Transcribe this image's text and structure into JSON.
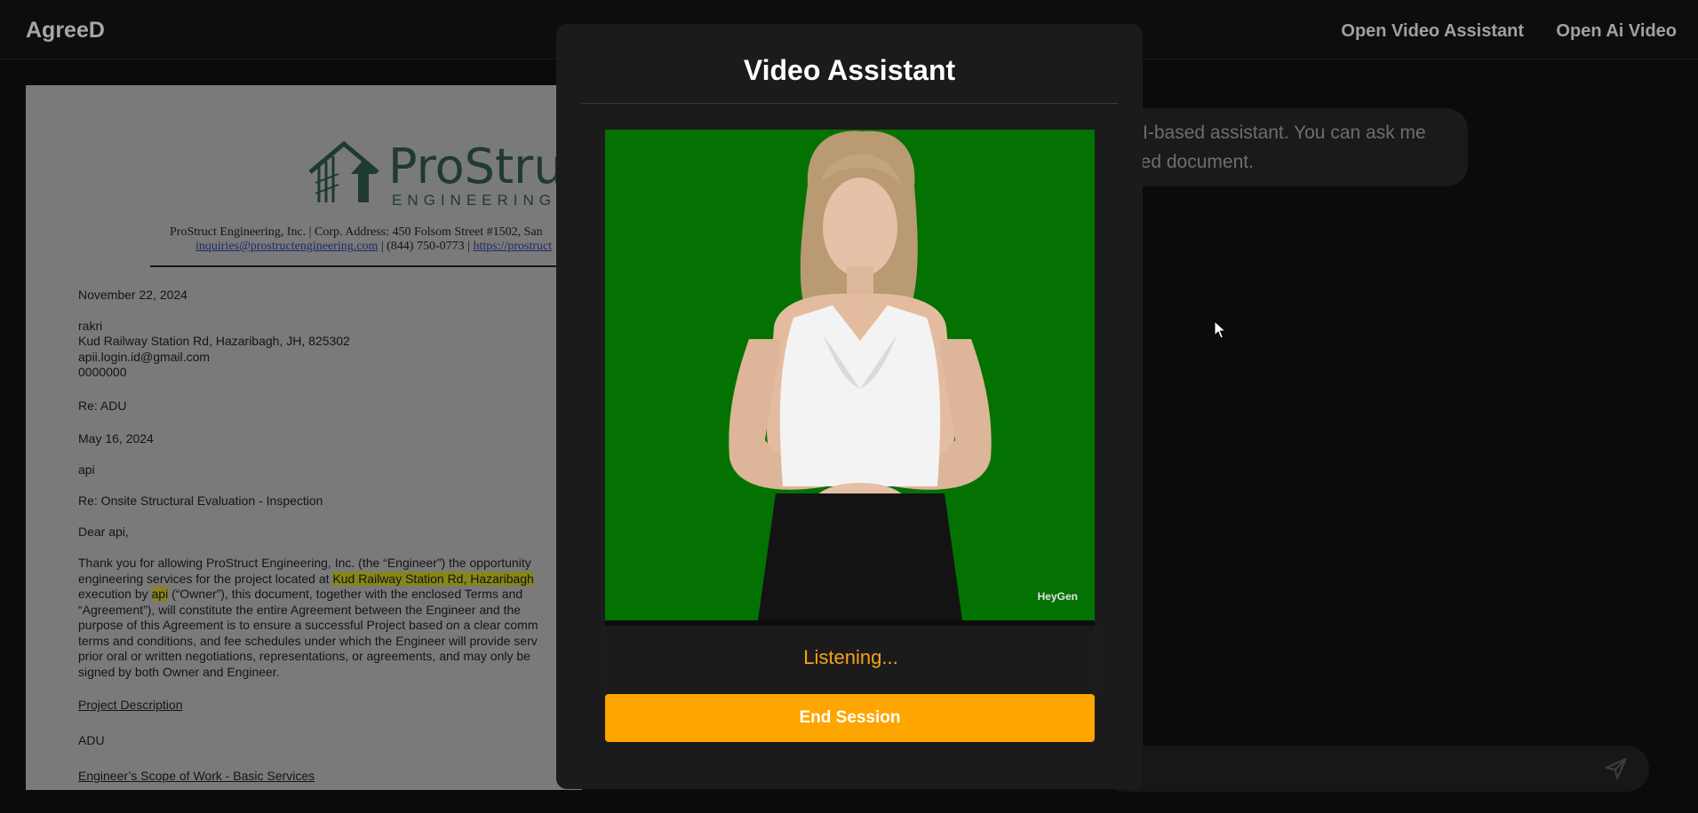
{
  "header": {
    "brand": "AgreeD",
    "nav": [
      "Open Video Assistant",
      "Open Ai Video"
    ]
  },
  "document": {
    "logo_name": "ProStruct",
    "logo_sub": "ENGINEERING",
    "address_line": "ProStruct Engineering, Inc. | Corp. Address: 450 Folsom Street #1502, San",
    "email_link": "inquiries@prostructengineering.com",
    "phone": " | (844) 750-0773 | ",
    "site_link": "https://prostruct",
    "date": "November 22, 2024",
    "client_name": "rakri",
    "client_address": "Kud Railway Station Rd, Hazaribagh, JH, 825302",
    "client_email": "apii.login.id@gmail.com",
    "client_phone": "0000000",
    "re_project": "Re: ADU",
    "second_date": "May 16, 2024",
    "owner": "api",
    "re_subject": "Re: Onsite Structural Evaluation - Inspection",
    "salutation": "Dear api,",
    "body": {
      "l1": "Thank you for allowing ProStruct Engineering, Inc. (the “Engineer”) the opportunity",
      "l2_pre": "engineering services for the project located at ",
      "l2_hl": "Kud Railway Station Rd, Hazaribagh",
      "l3_pre": "execution by ",
      "l3_hl": "api",
      "l3_post": " (“Owner”), this document, together with the enclosed Terms and",
      "l4": "“Agreement”), will constitute the entire Agreement between the Engineer and the",
      "l5": "purpose of this Agreement is to ensure a successful Project based on a clear comm",
      "l6": "terms and conditions, and fee schedules under which the Engineer will provide serv",
      "l7": "prior oral or written negotiations, representations, or agreements, and may only be",
      "l8": "signed by both Owner and Engineer."
    },
    "section_project": "Project Description",
    "project_type": "ADU",
    "section_scope": "Engineer’s Scope of Work - Basic Services"
  },
  "chat": {
    "bubble_line1": "AI-based assistant. You can ask me",
    "bubble_line2": "ded document."
  },
  "modal": {
    "title": "Video Assistant",
    "watermark": "HeyGen",
    "status": "Listening...",
    "end_button": "End Session"
  },
  "colors": {
    "accent": "#ffa500",
    "status_text": "#f5a317",
    "video_background": "#037203"
  },
  "icons": {
    "send": "send-icon",
    "cursor": "mouse-cursor-icon"
  }
}
